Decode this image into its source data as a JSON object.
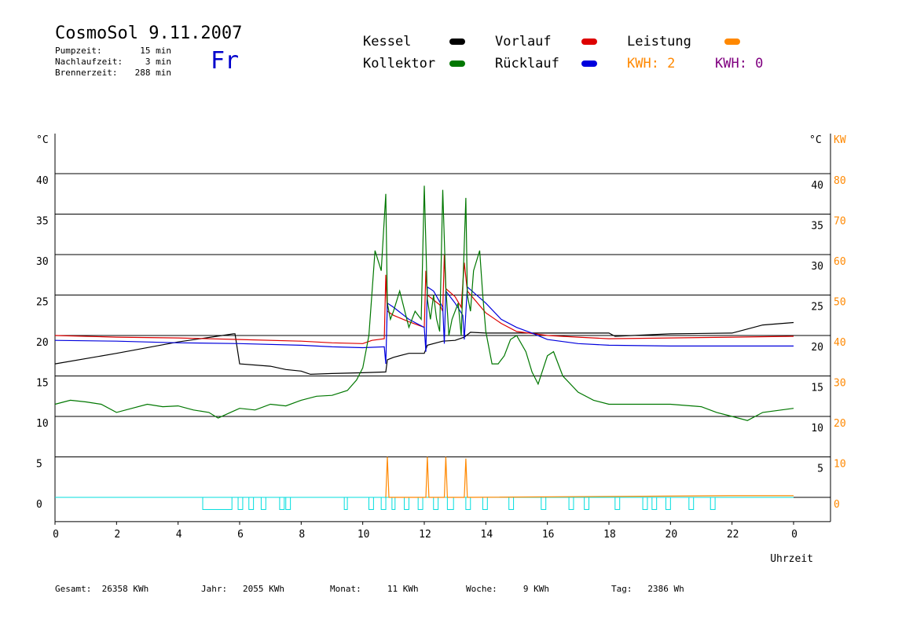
{
  "header": {
    "title": "CosmoSol 9.11.2007",
    "weekday": "Fr",
    "info": [
      {
        "label": "Pumpzeit:",
        "value": "15 min"
      },
      {
        "label": "Nachlaufzeit:",
        "value": "3 min"
      },
      {
        "label": "Brennerzeit:",
        "value": "288 min"
      }
    ]
  },
  "legend": {
    "kessel": "Kessel",
    "kollektor": "Kollektor",
    "vorlauf": "Vorlauf",
    "ruecklauf": "Rücklauf",
    "leistung": "Leistung",
    "kwh1": "KWH: 2",
    "kwh2": "KWH: 0"
  },
  "colors": {
    "kessel": "#000000",
    "kollektor": "#007700",
    "vorlauf": "#dd0000",
    "ruecklauf": "#0000dd",
    "leistung": "#ff8800",
    "kwh2": "#800080",
    "pump": "#00dddd"
  },
  "footer": {
    "gesamt": "Gesamt:  26358 KWh",
    "jahr": "Jahr:   2055 KWh",
    "monat": "Monat:     11 KWh",
    "woche": "Woche:     9 KWh",
    "tag": "Tag:   2386 Wh"
  },
  "chart_data": {
    "type": "line",
    "xlabel": "Uhrzeit",
    "ylabel_left": "°C",
    "ylabel_right_c": "°C",
    "ylabel_right_kw": "KW",
    "x_ticks": [
      "0",
      "2",
      "4",
      "6",
      "8",
      "10",
      "12",
      "14",
      "16",
      "18",
      "20",
      "22",
      "0"
    ],
    "y_ticks_left": [
      "40",
      "35",
      "30",
      "25",
      "20",
      "15",
      "10",
      "5",
      "0"
    ],
    "y_ticks_right_c": [
      "40",
      "35",
      "30",
      "25",
      "20",
      "15",
      "10",
      "5"
    ],
    "y_ticks_right_kw": [
      "80",
      "70",
      "60",
      "50",
      "40",
      "30",
      "20",
      "10",
      "0"
    ],
    "xlim": [
      0,
      24
    ],
    "ylim": [
      -3,
      45
    ],
    "series": [
      {
        "name": "Kessel",
        "color": "#000000",
        "x": [
          0,
          2,
          4,
          5.8,
          5.85,
          6,
          7,
          7.5,
          8,
          8.3,
          9,
          10,
          10.75,
          10.8,
          11,
          11.5,
          12,
          12.1,
          12.6,
          13,
          13.3,
          13.5,
          14,
          16,
          18,
          18.2,
          20,
          22,
          23,
          24
        ],
        "y": [
          16.5,
          17.8,
          19.2,
          20.2,
          20.2,
          16.5,
          16.2,
          15.8,
          15.6,
          15.2,
          15.3,
          15.4,
          15.5,
          17.0,
          17.3,
          17.8,
          17.8,
          18.8,
          19.3,
          19.4,
          19.8,
          20.4,
          20.3,
          20.3,
          20.3,
          19.9,
          20.2,
          20.3,
          21.3,
          21.6
        ]
      },
      {
        "name": "Vorlauf",
        "color": "#dd0000",
        "x": [
          0,
          2,
          4,
          6,
          8,
          9,
          10,
          10.3,
          10.7,
          10.75,
          10.8,
          11,
          11.5,
          12,
          12.05,
          12.1,
          12.5,
          12.6,
          12.65,
          12.7,
          13,
          13.2,
          13.3,
          13.4,
          14,
          14.5,
          15,
          16,
          17,
          18,
          20,
          22,
          24
        ],
        "y": [
          20.0,
          19.8,
          19.7,
          19.5,
          19.3,
          19.1,
          19.0,
          19.4,
          19.6,
          27.5,
          23.0,
          22.5,
          21.7,
          21.0,
          28.0,
          25.0,
          23.8,
          23.0,
          30.0,
          25.8,
          24.8,
          23.5,
          29.0,
          25.5,
          22.8,
          21.5,
          20.5,
          20.0,
          19.8,
          19.6,
          19.7,
          19.8,
          19.9
        ]
      },
      {
        "name": "Rücklauf",
        "color": "#0000dd",
        "x": [
          0,
          2,
          4,
          6,
          8,
          9,
          10,
          10.7,
          10.75,
          10.8,
          11,
          11.5,
          12,
          12.05,
          12.1,
          12.3,
          12.6,
          12.65,
          12.7,
          13,
          13.25,
          13.3,
          13.4,
          14,
          14.5,
          15,
          15.5,
          16,
          17,
          18,
          20,
          22,
          24
        ],
        "y": [
          19.4,
          19.3,
          19.1,
          19.0,
          18.8,
          18.6,
          18.5,
          18.6,
          16.5,
          24.0,
          23.5,
          22.0,
          21.0,
          18.0,
          26.0,
          25.5,
          23.5,
          19.0,
          25.5,
          24.0,
          22.5,
          19.5,
          26.0,
          24.0,
          22.0,
          21.0,
          20.3,
          19.5,
          19.0,
          18.8,
          18.7,
          18.7,
          18.7
        ]
      },
      {
        "name": "Kollektor",
        "color": "#007700",
        "x": [
          0,
          0.5,
          1,
          1.5,
          2,
          2.5,
          3,
          3.5,
          4,
          4.5,
          5,
          5.3,
          5.7,
          6,
          6.5,
          7,
          7.5,
          8,
          8.5,
          9,
          9.5,
          9.8,
          10,
          10.2,
          10.4,
          10.6,
          10.75,
          10.8,
          10.9,
          11,
          11.2,
          11.3,
          11.5,
          11.7,
          11.9,
          12,
          12.1,
          12.2,
          12.3,
          12.4,
          12.5,
          12.6,
          12.7,
          12.75,
          12.8,
          12.9,
          13.1,
          13.2,
          13.35,
          13.4,
          13.5,
          13.6,
          13.8,
          13.9,
          14,
          14.2,
          14.4,
          14.6,
          14.8,
          15,
          15.3,
          15.5,
          15.7,
          16,
          16.2,
          16.5,
          17,
          17.5,
          18,
          19,
          20,
          21,
          21.5,
          22,
          22.5,
          23,
          24
        ],
        "y": [
          11.5,
          12.0,
          11.8,
          11.5,
          10.5,
          11.0,
          11.5,
          11.2,
          11.3,
          10.8,
          10.5,
          9.8,
          10.5,
          11.0,
          10.8,
          11.5,
          11.3,
          12.0,
          12.5,
          12.6,
          13.2,
          14.5,
          16.0,
          20.0,
          30.5,
          28.0,
          37.5,
          24.0,
          22.0,
          23.0,
          25.5,
          24.0,
          21.0,
          23.0,
          22.0,
          38.5,
          24.5,
          22.0,
          25.0,
          22.0,
          20.5,
          38.0,
          26.0,
          23.0,
          20.0,
          22.0,
          24.0,
          20.0,
          37.0,
          25.0,
          23.0,
          28.0,
          30.5,
          25.0,
          20.5,
          16.5,
          16.5,
          17.5,
          19.5,
          20.0,
          18.0,
          15.5,
          14.0,
          17.5,
          18.0,
          15.0,
          13.0,
          12.0,
          11.5,
          11.5,
          11.5,
          11.2,
          10.5,
          10.0,
          9.5,
          10.5,
          11.0
        ]
      },
      {
        "name": "Leistung",
        "color": "#ff8800",
        "x": [
          10.75,
          10.8,
          10.85,
          12.05,
          12.1,
          12.15,
          12.65,
          12.7,
          12.75,
          13.3,
          13.35,
          13.4,
          21.9,
          24
        ],
        "y": [
          0,
          5,
          0,
          0,
          5,
          0,
          0,
          5,
          0,
          0,
          4.8,
          0,
          0.2,
          0.2
        ]
      }
    ],
    "pump_intervals": [
      [
        4.8,
        5.75
      ],
      [
        5.95,
        6.1
      ],
      [
        6.3,
        6.45
      ],
      [
        6.7,
        6.85
      ],
      [
        7.3,
        7.45
      ],
      [
        7.5,
        7.65
      ],
      [
        9.4,
        9.5
      ],
      [
        10.2,
        10.35
      ],
      [
        10.6,
        10.75
      ],
      [
        10.95,
        11.05
      ],
      [
        11.35,
        11.5
      ],
      [
        11.8,
        11.95
      ],
      [
        12.3,
        12.45
      ],
      [
        12.75,
        12.95
      ],
      [
        13.35,
        13.5
      ],
      [
        13.9,
        14.05
      ],
      [
        14.75,
        14.9
      ],
      [
        15.8,
        15.95
      ],
      [
        16.7,
        16.85
      ],
      [
        17.2,
        17.35
      ],
      [
        18.2,
        18.35
      ],
      [
        19.1,
        19.25
      ],
      [
        19.4,
        19.55
      ],
      [
        19.85,
        20.0
      ],
      [
        20.6,
        20.75
      ],
      [
        21.3,
        21.45
      ]
    ]
  }
}
